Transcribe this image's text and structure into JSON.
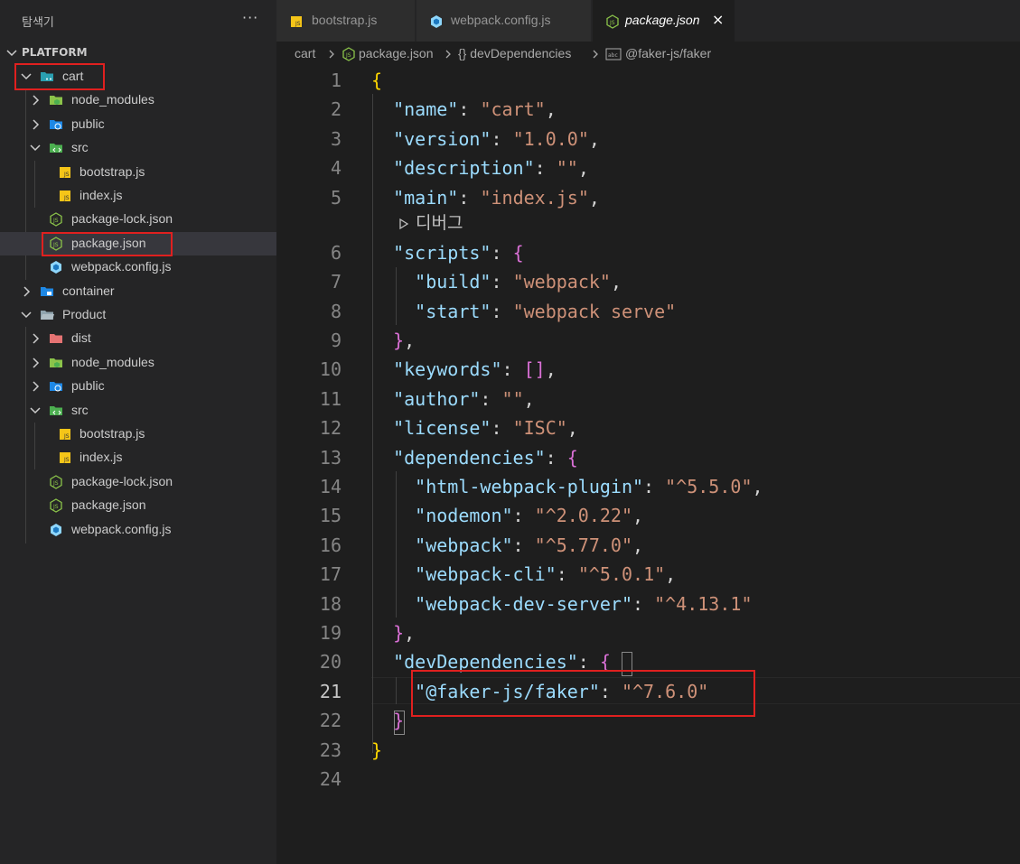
{
  "sidebar": {
    "title": "탐색기",
    "more": "···",
    "section_title": "PLATFORM",
    "items": [
      {
        "label": "cart"
      },
      {
        "label": "node_modules"
      },
      {
        "label": "public"
      },
      {
        "label": "src"
      },
      {
        "label": "bootstrap.js"
      },
      {
        "label": "index.js"
      },
      {
        "label": "package-lock.json"
      },
      {
        "label": "package.json"
      },
      {
        "label": "webpack.config.js"
      },
      {
        "label": "container"
      },
      {
        "label": "Product"
      },
      {
        "label": "dist"
      },
      {
        "label": "node_modules"
      },
      {
        "label": "public"
      },
      {
        "label": "src"
      },
      {
        "label": "bootstrap.js"
      },
      {
        "label": "index.js"
      },
      {
        "label": "package-lock.json"
      },
      {
        "label": "package.json"
      },
      {
        "label": "webpack.config.js"
      }
    ]
  },
  "tabs": [
    {
      "label": "bootstrap.js",
      "icon": "js-file-icon"
    },
    {
      "label": "webpack.config.js",
      "icon": "webpack-icon"
    },
    {
      "label": "package.json",
      "icon": "nodejs-icon",
      "close": "×"
    }
  ],
  "breadcrumb": {
    "items": [
      "cart",
      "package.json",
      "{} devDependencies",
      "@faker-js/faker"
    ]
  },
  "editor": {
    "codelens": "디버그",
    "line_numbers": [
      "1",
      "2",
      "3",
      "4",
      "5",
      "6",
      "7",
      "8",
      "9",
      "10",
      "11",
      "12",
      "13",
      "14",
      "15",
      "16",
      "17",
      "18",
      "19",
      "20",
      "21",
      "22",
      "23",
      "24"
    ],
    "current_line": "21",
    "json": {
      "name": "cart",
      "version": "1.0.0",
      "description": "",
      "main": "index.js",
      "scripts": {
        "build": "webpack",
        "start": "webpack serve"
      },
      "keywords": "[]",
      "author": "",
      "license": "ISC",
      "dependencies": {
        "html-webpack-plugin": "^5.5.0",
        "nodemon": "^2.0.22",
        "webpack": "^5.77.0",
        "webpack-cli": "^5.0.1",
        "webpack-dev-server": "^4.13.1"
      },
      "devDependencies": {
        "@faker-js/faker": "^7.6.0"
      }
    }
  },
  "colors": {
    "highlight": "#e0201f",
    "key": "#9cdcfe",
    "string": "#ce9178",
    "bracket_gold": "#ffd700",
    "bracket_purple": "#da70d6"
  }
}
